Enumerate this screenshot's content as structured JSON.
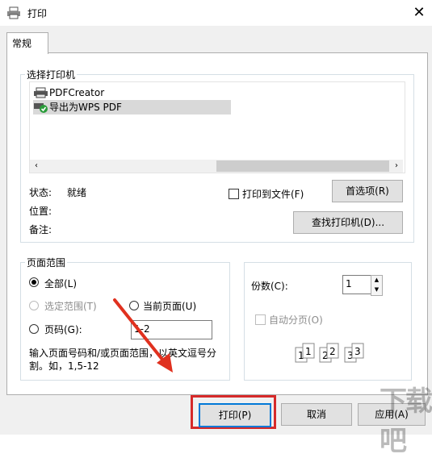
{
  "window": {
    "title": "打印",
    "close_glyph": "✕"
  },
  "tabs": [
    {
      "label": "常规"
    }
  ],
  "printer_group": {
    "legend": "选择打印机",
    "printers": [
      {
        "name": "PDFCreator"
      },
      {
        "name": "导出为WPS PDF",
        "selected": true
      }
    ],
    "status_label": "状态:",
    "status_value": "就绪",
    "location_label": "位置:",
    "comment_label": "备注:",
    "print_to_file_label": "打印到文件(F)",
    "preferences_button": "首选项(R)",
    "find_printer_button": "查找打印机(D)..."
  },
  "page_range": {
    "legend": "页面范围",
    "all_label": "全部(L)",
    "selection_label": "选定范围(T)",
    "current_page_label": "当前页面(U)",
    "pages_label": "页码(G):",
    "pages_value": "1-2",
    "hint": "输入页面号码和/或页面范围，以英文逗号分割。如，1,5-12"
  },
  "copies": {
    "label": "份数(C):",
    "value": "1",
    "collate_label": "自动分页(O)"
  },
  "buttons": {
    "print": "打印(P)",
    "cancel": "取消",
    "apply": "应用(A)"
  },
  "watermark": {
    "text": "下载吧"
  },
  "colors": {
    "highlight_box": "#d62a2a",
    "arrow": "#e0311f"
  }
}
